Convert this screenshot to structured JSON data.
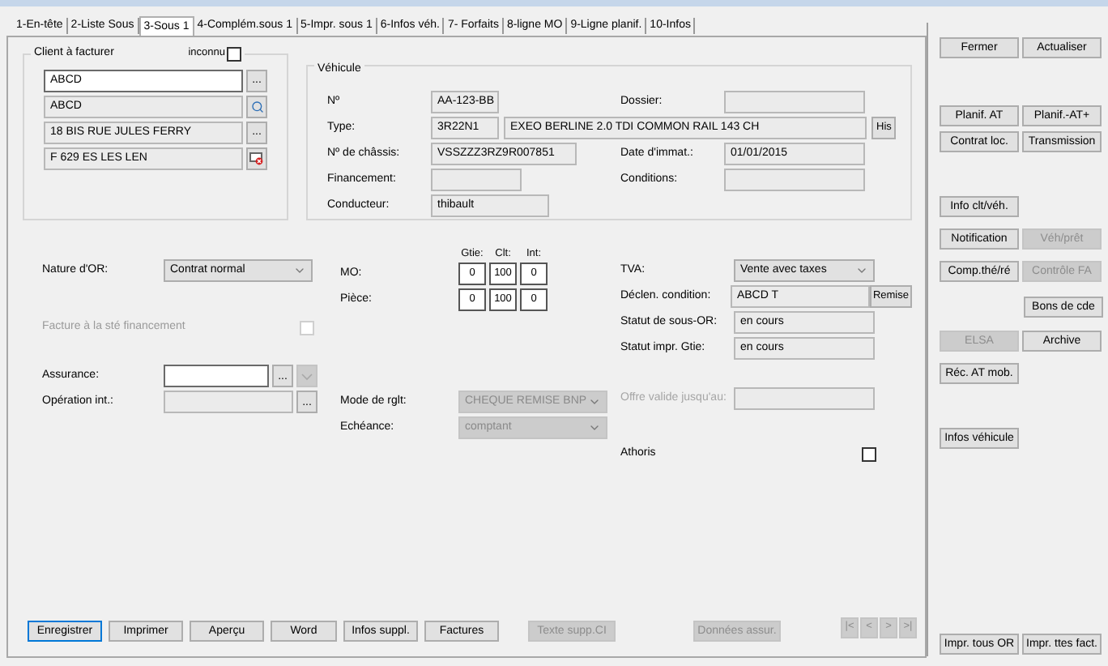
{
  "tabs": [
    {
      "label": "1-En-tête",
      "selected": false
    },
    {
      "label": "2-Liste Sous",
      "selected": false
    },
    {
      "label": "3-Sous 1",
      "selected": true
    },
    {
      "label": "4-Complém.sous 1",
      "selected": false
    },
    {
      "label": "5-Impr. sous 1",
      "selected": false
    },
    {
      "label": "6-Infos véh.",
      "selected": false
    },
    {
      "label": "7- Forfaits",
      "selected": false
    },
    {
      "label": "8-ligne MO",
      "selected": false
    },
    {
      "label": "9-Ligne planif.",
      "selected": false
    },
    {
      "label": "10-Infos",
      "selected": false
    }
  ],
  "client": {
    "title": "Client à facturer",
    "unknown": {
      "label": "inconnu",
      "checked": false
    },
    "fields": [
      {
        "value": "ABCD",
        "editable": true,
        "button": {
          "kind": "text",
          "label": "..."
        }
      },
      {
        "value": "ABCD",
        "editable": false,
        "button": {
          "kind": "search"
        }
      },
      {
        "value": "18 BIS RUE JULES FERRY",
        "editable": false,
        "button": {
          "kind": "text",
          "label": "..."
        }
      },
      {
        "value": "F 629            ES LES LEN",
        "editable": false,
        "button": {
          "kind": "remove"
        }
      }
    ]
  },
  "vehicle": {
    "title": "Véhicule",
    "rows": [
      {
        "label": "Nº",
        "values": [
          "AA-123-BB"
        ],
        "right": {
          "label": "Dossier:"
        }
      },
      {
        "label": "Type:",
        "values": [
          "3R22N1",
          "EXEO BERLINE 2.0 TDI COMMON RAIL 143 CH"
        ],
        "button": "His"
      },
      {
        "label": "Nº de châssis:",
        "values": [
          "VSSZZZ3RZ9R007851"
        ],
        "right": {
          "label": "Date d'immat.:",
          "value": "01/01/2015"
        }
      },
      {
        "label": "Financement:",
        "right": {
          "label": "Conditions:"
        }
      },
      {
        "label": "Conducteur:",
        "values": [
          "thibault"
        ]
      }
    ]
  },
  "form": {
    "nature": {
      "label": "Nature d'OR:",
      "value": "Contrat normal"
    },
    "facture_financement": {
      "label": "Facture à la sté financement",
      "disabled": true,
      "checked": false
    },
    "assurance": {
      "label": "Assurance:",
      "button": "..."
    },
    "operation": {
      "label": "Opération int.:",
      "button": "..."
    },
    "split": {
      "columns": [
        "Gtie:",
        "Clt:",
        "Int:"
      ],
      "rows": [
        {
          "label": "MO:",
          "values": [
            "0",
            "100",
            "0"
          ]
        },
        {
          "label": "Pièce:",
          "values": [
            "0",
            "100",
            "0"
          ]
        }
      ]
    },
    "mode_rglt": {
      "label": "Mode de rglt:",
      "value": "CHEQUE REMISE BNP",
      "disabled": true
    },
    "echeance": {
      "label": "Echéance:",
      "value": "comptant",
      "disabled": true
    },
    "tva": {
      "label": "TVA:",
      "value": "Vente avec taxes"
    },
    "declen": {
      "label": "Déclen. condition:",
      "value": "ABCD T",
      "button": "Remise"
    },
    "statuts": [
      {
        "label": "Statut de sous-OR:",
        "value": "en cours"
      },
      {
        "label": "Statut impr. Gtie:",
        "value": "en cours"
      }
    ],
    "offre": {
      "label": "Offre valide jusqu'au:",
      "disabled": true
    },
    "athoris": {
      "label": "Athoris",
      "checked": false
    }
  },
  "bottom_buttons": [
    {
      "label": "Enregistrer",
      "disabled": false,
      "focused": true
    },
    {
      "label": "Imprimer",
      "disabled": false,
      "focused": false
    },
    {
      "label": "Aperçu",
      "disabled": false,
      "focused": false
    },
    {
      "label": "Word",
      "disabled": false,
      "focused": false
    },
    {
      "label": "Infos suppl.",
      "disabled": false,
      "focused": false
    },
    {
      "label": "Factures",
      "disabled": false,
      "focused": false
    },
    {
      "label": "Texte supp.CI",
      "disabled": true,
      "focused": false
    },
    {
      "label": "Données assur.",
      "disabled": true,
      "focused": false
    }
  ],
  "navigation": [
    {
      "label": "|<",
      "disabled": true
    },
    {
      "label": "<",
      "disabled": true
    },
    {
      "label": ">",
      "disabled": true
    },
    {
      "label": ">|",
      "disabled": true
    }
  ],
  "side_buttons": [
    [
      {
        "label": "Fermer",
        "disabled": false
      },
      {
        "label": "Actualiser",
        "disabled": false
      }
    ],
    [
      {
        "label": "Planif. AT",
        "disabled": false
      },
      {
        "label": "Planif.-AT+",
        "disabled": false
      }
    ],
    [
      {
        "label": "Contrat loc.",
        "disabled": false
      },
      {
        "label": "Transmission",
        "disabled": false
      }
    ],
    [
      {
        "label": "Info clt/véh.",
        "disabled": false
      }
    ],
    [
      {
        "label": "Notification",
        "disabled": false
      },
      {
        "label": "Véh/prêt",
        "disabled": true
      }
    ],
    [
      {
        "label": "Comp.thé/ré",
        "disabled": false
      },
      {
        "label": "Contrôle FA",
        "disabled": true
      }
    ],
    [
      {
        "label": "Bons de cde",
        "disabled": false
      }
    ],
    [
      {
        "label": "ELSA",
        "disabled": true
      },
      {
        "label": "Archive",
        "disabled": false
      }
    ],
    [
      {
        "label": "Réc. AT mob.",
        "disabled": false
      }
    ],
    [
      {
        "label": "Infos véhicule",
        "disabled": false
      }
    ],
    [
      {
        "label": "Impr. tous OR",
        "disabled": false
      },
      {
        "label": "Impr. ttes fact.",
        "disabled": false
      }
    ]
  ]
}
